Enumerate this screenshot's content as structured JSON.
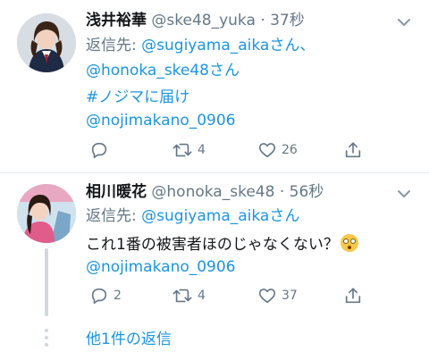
{
  "tweet1": {
    "name": "浅井裕華",
    "handle": "@ske48_yuka",
    "time": "· 37秒",
    "reply_prefix": "返信先: ",
    "reply_to_1": "@sugiyama_aika",
    "reply_sep": "さん、",
    "reply_to_2": "@honoka_ske48",
    "reply_suffix": "さん",
    "hashtag": "#ノジマに届け",
    "mention": "@nojimakano_0906",
    "retweets": "4",
    "likes": "26"
  },
  "tweet2": {
    "name": "相川暖花",
    "handle": "@honoka_ske48",
    "time": "· 56秒",
    "reply_prefix": "返信先: ",
    "reply_to_1": "@sugiyama_aika",
    "reply_suffix": "さん",
    "text": "これ1番の被害者ほのじゃなくない？",
    "mention": "@nojimakano_0906",
    "replies": "2",
    "retweets": "4",
    "likes": "37"
  },
  "more_replies": "他1件の返信",
  "colors": {
    "link": "#1b95e0",
    "secondary": "#657786",
    "text": "#14171a"
  },
  "icons": [
    "chevron-down-icon",
    "reply-icon",
    "retweet-icon",
    "like-icon",
    "share-icon",
    "flushed-face-emoji"
  ]
}
